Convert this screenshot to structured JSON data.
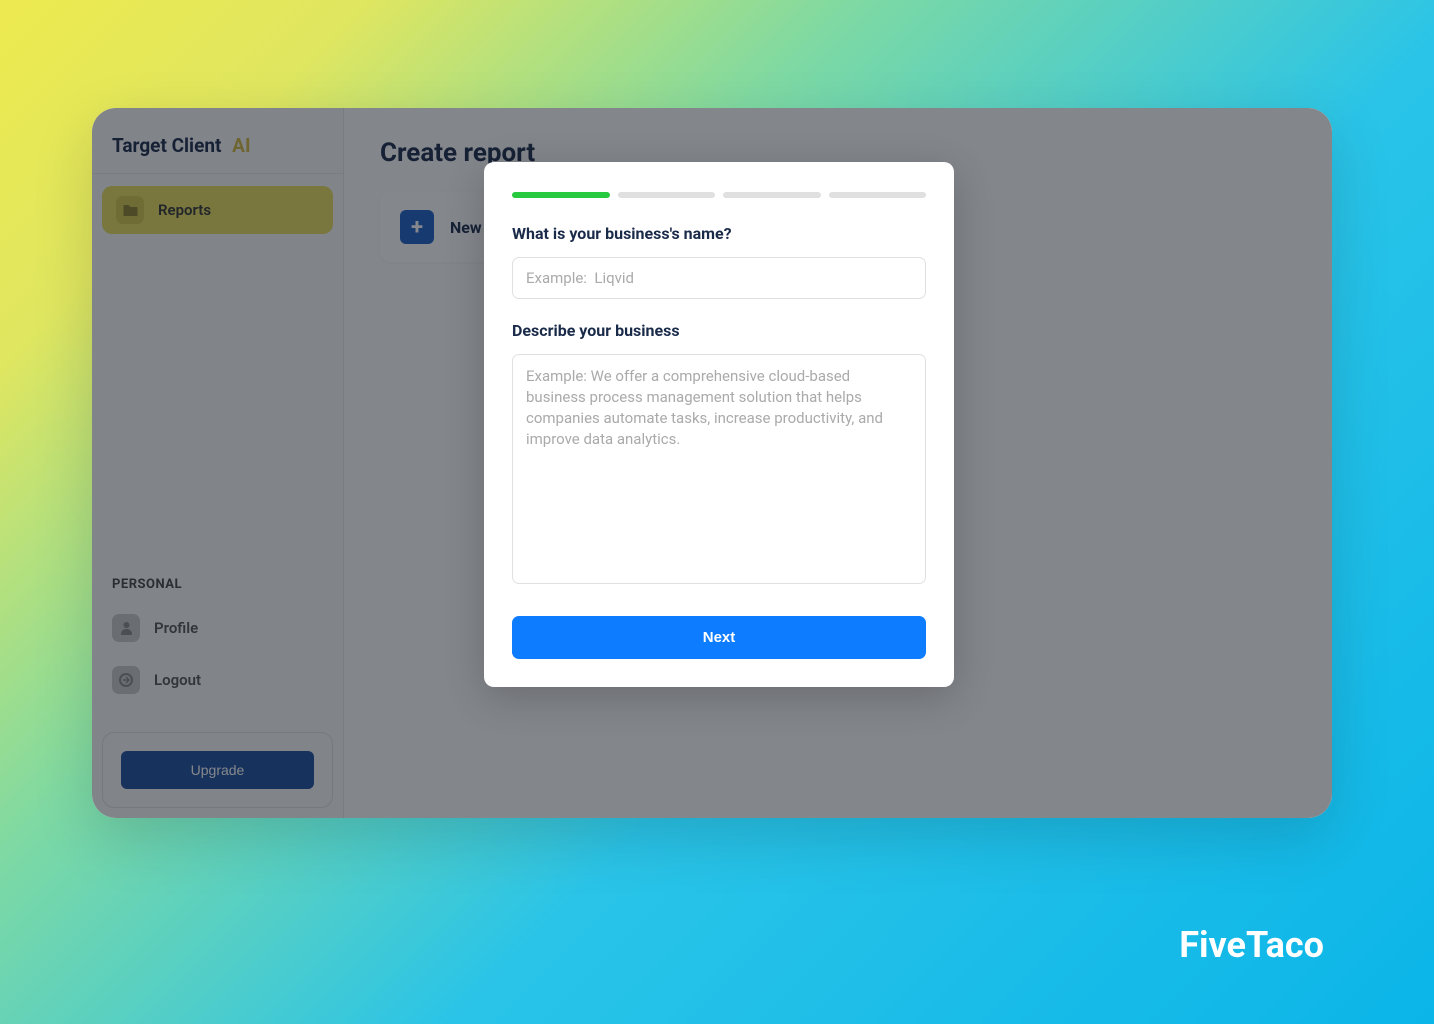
{
  "brand": {
    "name": "Target Client",
    "suffix": "AI"
  },
  "sidebar": {
    "nav": {
      "reports": "Reports"
    },
    "personal": {
      "heading": "PERSONAL",
      "profile": "Profile",
      "logout": "Logout"
    },
    "upgrade_label": "Upgrade"
  },
  "main": {
    "page_title": "Create report",
    "new_report_label": "New"
  },
  "modal": {
    "progress_steps": 4,
    "progress_current": 1,
    "q1_label": "What is your business's name?",
    "q1_placeholder": "Example:  Liqvid",
    "q2_label": "Describe your business",
    "q2_placeholder": "Example: We offer a comprehensive cloud-based business process management solution that helps companies automate tasks, increase productivity, and improve data analytics.",
    "next_label": "Next"
  },
  "watermark": "FiveTaco"
}
